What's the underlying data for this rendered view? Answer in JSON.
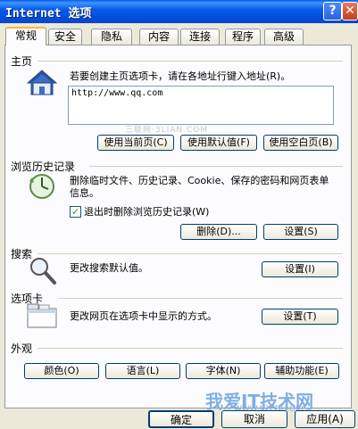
{
  "window": {
    "title": "Internet 选项"
  },
  "titlebar": {
    "help_label": "?",
    "close_label": "✕"
  },
  "tabs": [
    {
      "label": "常规",
      "active": true
    },
    {
      "label": "安全"
    },
    {
      "label": "隐私"
    },
    {
      "label": "内容"
    },
    {
      "label": "连接"
    },
    {
      "label": "程序"
    },
    {
      "label": "高级"
    }
  ],
  "homepage": {
    "section_title": "主页",
    "description": "若要创建主页选项卡，请在各地址行键入地址(R)。",
    "url_value": "http://www.qq.com",
    "buttons": {
      "use_current": "使用当前页(C)",
      "use_default": "使用默认值(F)",
      "use_blank": "使用空白页(B)"
    }
  },
  "history": {
    "section_title": "浏览历史记录",
    "description": "删除临时文件、历史记录、Cookie、保存的密码和网页表单信息。",
    "checkbox_label": "退出时删除浏览历史记录(W)",
    "checkbox_checked": true,
    "buttons": {
      "delete": "删除(D)...",
      "settings": "设置(S)"
    }
  },
  "search": {
    "section_title": "搜索",
    "description": "更改搜索默认值。",
    "settings_button": "设置(I)"
  },
  "tabs_section": {
    "section_title": "选项卡",
    "description": "更改网页在选项卡中显示的方式。",
    "settings_button": "设置(T)"
  },
  "appearance": {
    "section_title": "外观",
    "buttons": {
      "colors": "颜色(O)",
      "languages": "语言(L)",
      "fonts": "字体(N)",
      "accessibility": "辅助功能(E)"
    }
  },
  "footer": {
    "ok": "确定",
    "cancel": "取消",
    "apply": "应用(A)"
  },
  "watermarks": {
    "center": "三联网·3LIAN.COM",
    "brand": "我爱IT技术网",
    "brand_url": "WWW.52EDU.ORG"
  }
}
